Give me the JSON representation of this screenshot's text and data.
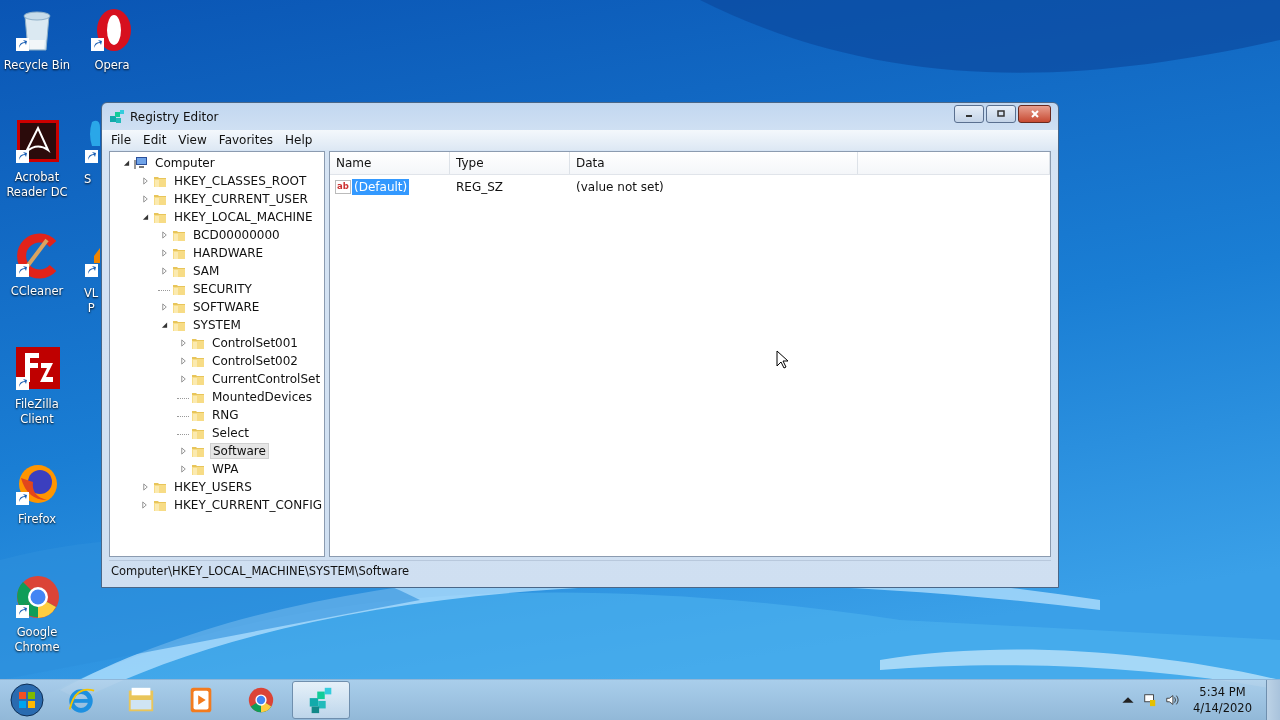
{
  "desktop_icons": [
    {
      "kind": "recycle",
      "lines": [
        "Recycle Bin"
      ]
    },
    {
      "kind": "opera",
      "lines": [
        "Opera"
      ]
    },
    {
      "kind": "acrobat",
      "lines": [
        "Acrobat",
        "Reader DC"
      ]
    },
    {
      "kind": "partial_blue",
      "lines": [
        "S"
      ]
    },
    {
      "kind": "ccleaner",
      "lines": [
        "CCleaner"
      ]
    },
    {
      "kind": "partial_vlc",
      "lines": [
        "VL",
        "P"
      ]
    },
    {
      "kind": "filezilla",
      "lines": [
        "FileZilla",
        "Client"
      ]
    },
    {
      "kind": "firefox",
      "lines": [
        "Firefox"
      ]
    },
    {
      "kind": "chrome",
      "lines": [
        "Google",
        "Chrome"
      ]
    }
  ],
  "window": {
    "title": "Registry Editor",
    "menu": [
      "File",
      "Edit",
      "View",
      "Favorites",
      "Help"
    ],
    "tree": [
      {
        "kind": "computer",
        "label": "Computer",
        "has_children": true,
        "expanded": true,
        "selected": false,
        "children": [
          {
            "kind": "folder",
            "label": "HKEY_CLASSES_ROOT",
            "has_children": true,
            "expanded": false,
            "selected": false
          },
          {
            "kind": "folder",
            "label": "HKEY_CURRENT_USER",
            "has_children": true,
            "expanded": false,
            "selected": false
          },
          {
            "kind": "folder",
            "label": "HKEY_LOCAL_MACHINE",
            "has_children": true,
            "expanded": true,
            "selected": false,
            "children": [
              {
                "kind": "folder",
                "label": "BCD00000000",
                "has_children": true,
                "expanded": false,
                "selected": false
              },
              {
                "kind": "folder",
                "label": "HARDWARE",
                "has_children": true,
                "expanded": false,
                "selected": false
              },
              {
                "kind": "folder",
                "label": "SAM",
                "has_children": true,
                "expanded": false,
                "selected": false
              },
              {
                "kind": "folder",
                "label": "SECURITY",
                "has_children": false,
                "selected": false
              },
              {
                "kind": "folder",
                "label": "SOFTWARE",
                "has_children": true,
                "expanded": false,
                "selected": false
              },
              {
                "kind": "folder",
                "label": "SYSTEM",
                "has_children": true,
                "expanded": true,
                "selected": false,
                "children": [
                  {
                    "kind": "folder",
                    "label": "ControlSet001",
                    "has_children": true,
                    "expanded": false,
                    "selected": false
                  },
                  {
                    "kind": "folder",
                    "label": "ControlSet002",
                    "has_children": true,
                    "expanded": false,
                    "selected": false
                  },
                  {
                    "kind": "folder",
                    "label": "CurrentControlSet",
                    "has_children": true,
                    "expanded": false,
                    "selected": false
                  },
                  {
                    "kind": "folder",
                    "label": "MountedDevices",
                    "has_children": false,
                    "selected": false
                  },
                  {
                    "kind": "folder",
                    "label": "RNG",
                    "has_children": false,
                    "selected": false
                  },
                  {
                    "kind": "folder",
                    "label": "Select",
                    "has_children": false,
                    "selected": false
                  },
                  {
                    "kind": "folder",
                    "label": "Software",
                    "has_children": true,
                    "expanded": false,
                    "selected": true
                  },
                  {
                    "kind": "folder",
                    "label": "WPA",
                    "has_children": true,
                    "expanded": false,
                    "selected": false
                  }
                ]
              }
            ]
          },
          {
            "kind": "folder",
            "label": "HKEY_USERS",
            "has_children": true,
            "expanded": false,
            "selected": false
          },
          {
            "kind": "folder",
            "label": "HKEY_CURRENT_CONFIG",
            "has_children": true,
            "expanded": false,
            "selected": false
          }
        ]
      }
    ],
    "columns": [
      "Name",
      "Type",
      "Data"
    ],
    "rows": [
      {
        "icon_text": "ab",
        "name": "(Default)",
        "type": "REG_SZ",
        "data": "(value not set)",
        "selected": true
      }
    ],
    "status_bar": "Computer\\HKEY_LOCAL_MACHINE\\SYSTEM\\Software"
  },
  "taskbar": {
    "items": [
      {
        "kind": "ie",
        "active": false
      },
      {
        "kind": "explorer",
        "active": false
      },
      {
        "kind": "media",
        "active": false
      },
      {
        "kind": "chrome",
        "active": false
      },
      {
        "kind": "regedit",
        "active": true
      }
    ],
    "time": "5:34 PM",
    "date": "4/14/2020"
  }
}
